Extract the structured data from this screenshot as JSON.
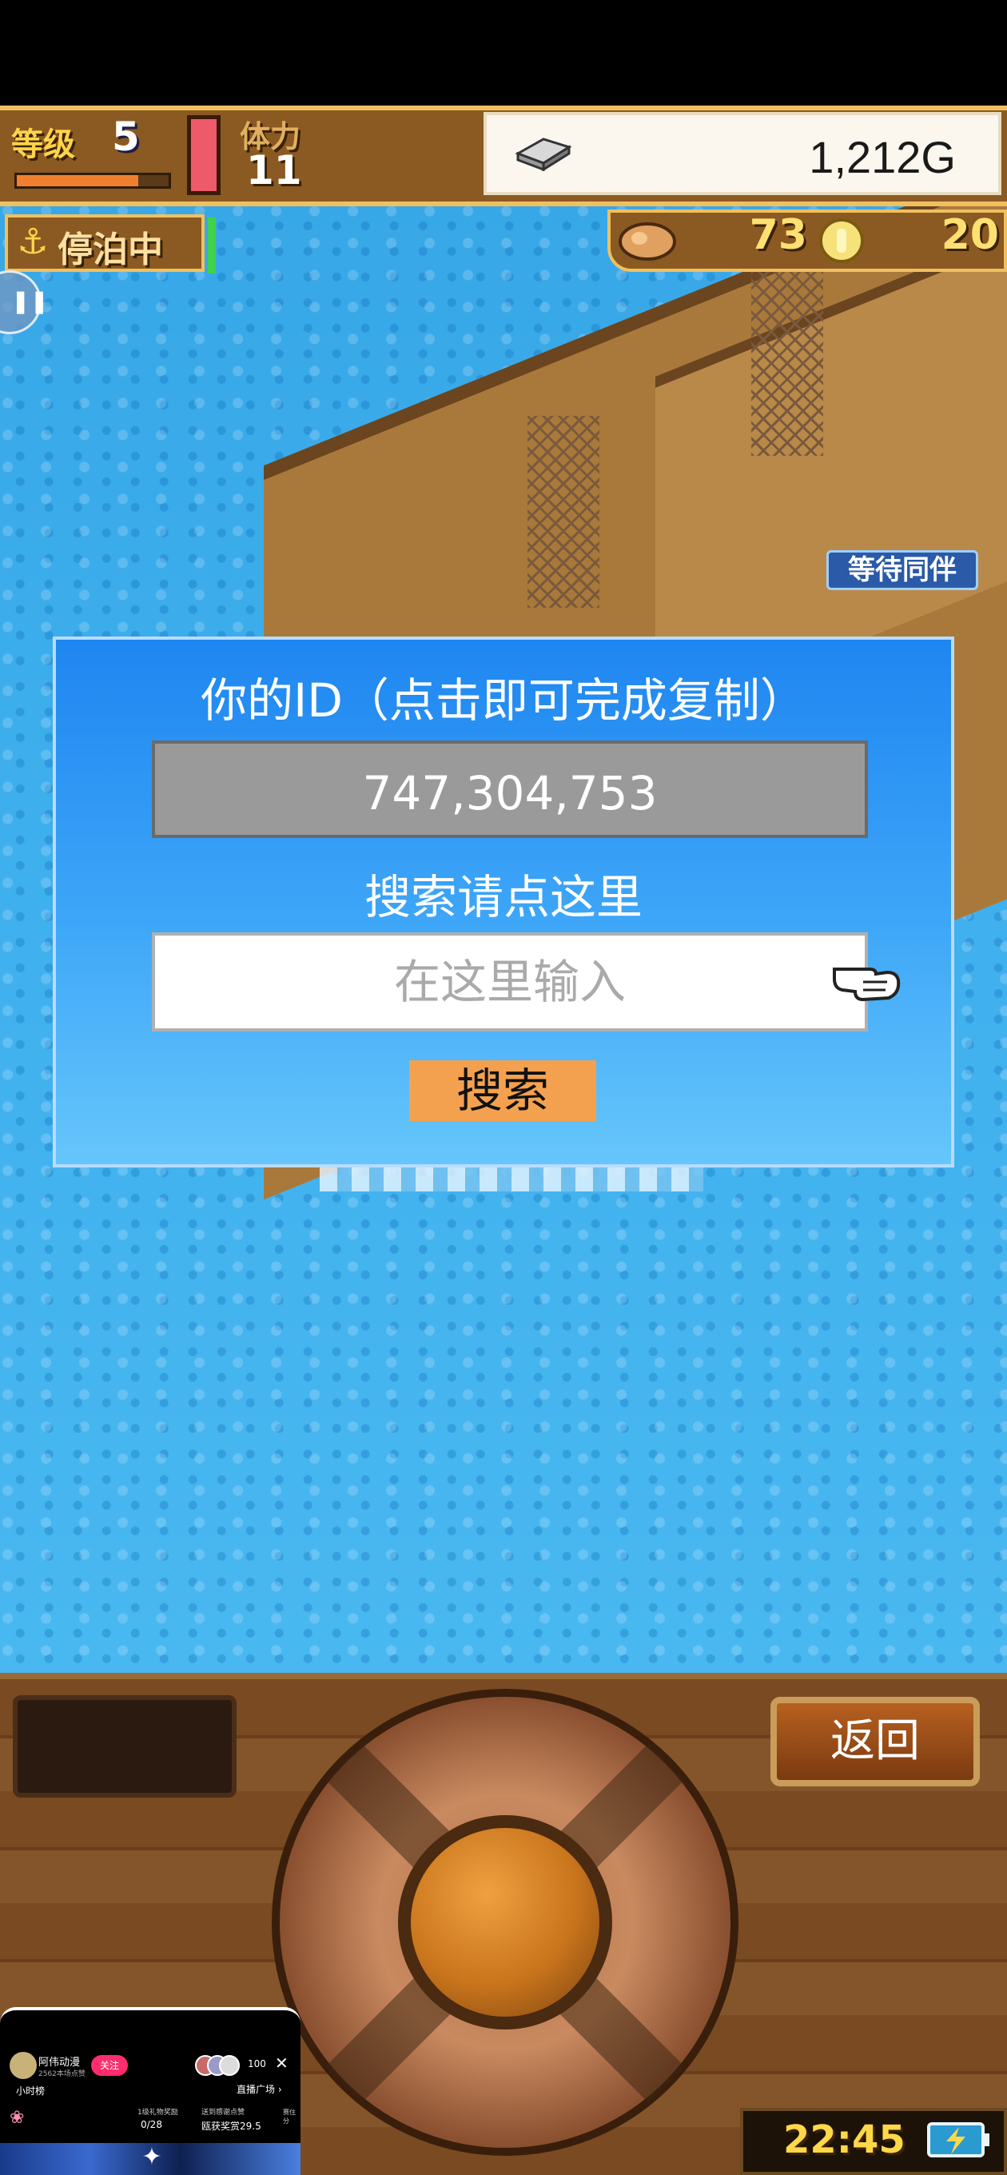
{
  "hud": {
    "level_label": "等级",
    "level_value": "5",
    "level_progress": 0.8,
    "stamina_label": "体力",
    "stamina_value": "11",
    "gold_value": "1,212G"
  },
  "status": {
    "docked_label": "停泊中",
    "anchor_icon": "⚓",
    "food_value": "73",
    "coin_value": "20"
  },
  "scene": {
    "waiting_tag": "等待同伴"
  },
  "dialog": {
    "title": "你的ID（点击即可完成复制）",
    "id_value": "747,304,753",
    "search_prompt": "搜索请点这里",
    "search_placeholder": "在这里输入",
    "search_button": "搜索"
  },
  "controls": {
    "back_button": "返回",
    "clock": "22:45"
  },
  "stream_overlay": {
    "name": "阿伟动漫",
    "fans": "2562本场点赞",
    "follow": "关注",
    "viewer_count": "100",
    "close": "✕",
    "hourly_rank": "小时榜",
    "live_square": "直播广场 ›",
    "stat_a_label": "1级礼物奖励",
    "stat_a_value": "0/28",
    "stat_b_label": "送到感谢点赞",
    "stat_b_value": "瓯获奖赏29.5",
    "stat_c_label": "赛住分"
  },
  "colors": {
    "hud_wood": "#8b5a22",
    "dialog_top": "#1e86f0",
    "dialog_bottom": "#66c6fb",
    "search_button": "#f4a14f",
    "id_field": "#9a9a9a"
  }
}
